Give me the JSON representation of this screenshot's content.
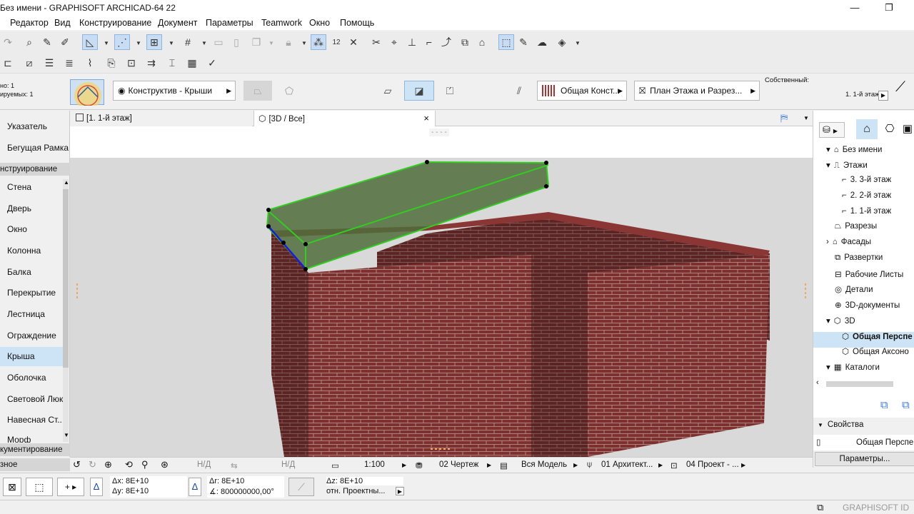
{
  "app": {
    "title": "Без имени - GRAPHISOFT ARCHICAD-64 22"
  },
  "window_buttons": {
    "minimize": "—",
    "maximize": "❐"
  },
  "menu": [
    "Редактор",
    "Вид",
    "Конструирование",
    "Документ",
    "Параметры",
    "Teamwork",
    "Окно",
    "Помощь"
  ],
  "infobox": {
    "left_info": [
      "но: 1",
      "ируемых: 1"
    ],
    "layer_combo": "Конструктив - Крыши",
    "material_combo": "Общая Конст...",
    "view_combo": "План Этажа и Разрез...",
    "own_label": "Собственный:",
    "floor_label": "1. 1-й этаж"
  },
  "toolbox": {
    "top_items": [
      "Указатель",
      "Бегущая Рамка"
    ],
    "group1": "нструирование",
    "items": [
      "Стена",
      "Дверь",
      "Окно",
      "Колонна",
      "Балка",
      "Перекрытие",
      "Лестница",
      "Ограждение",
      "Крыша",
      "Оболочка",
      "Световой Люк",
      "Навесная Ст...",
      "Морф"
    ],
    "selected": "Крыша",
    "group2": "кументирование",
    "group3": "зное"
  },
  "tabs": [
    {
      "label": "[1. 1-й этаж]"
    },
    {
      "label": "[3D / Все]",
      "close": "×"
    }
  ],
  "view_hint": "- - - -",
  "navigator": {
    "items": [
      {
        "label": "Без имени",
        "indent": 0,
        "toggle": "▾",
        "icon": "project-icon"
      },
      {
        "label": "Этажи",
        "indent": 1,
        "toggle": "▾",
        "icon": "stories-icon"
      },
      {
        "label": "3. 3-й этаж",
        "indent": 2,
        "toggle": "",
        "icon": "story-icon"
      },
      {
        "label": "2. 2-й этаж",
        "indent": 2,
        "toggle": "",
        "icon": "story-icon"
      },
      {
        "label": "1. 1-й этаж",
        "indent": 2,
        "toggle": "",
        "icon": "story-icon"
      },
      {
        "label": "Разрезы",
        "indent": 1,
        "toggle": "",
        "icon": "section-icon"
      },
      {
        "label": "Фасады",
        "indent": 1,
        "toggle": "›",
        "icon": "elevation-icon"
      },
      {
        "label": "Развертки",
        "indent": 1,
        "toggle": "",
        "icon": "interior-elevation-icon"
      },
      {
        "label": "Рабочие Листы",
        "indent": 1,
        "toggle": "",
        "icon": "worksheet-icon"
      },
      {
        "label": "Детали",
        "indent": 1,
        "toggle": "",
        "icon": "detail-icon"
      },
      {
        "label": "3D-документы",
        "indent": 1,
        "toggle": "",
        "icon": "3d-document-icon"
      },
      {
        "label": "3D",
        "indent": 1,
        "toggle": "▾",
        "icon": "3d-icon"
      },
      {
        "label": "Общая Перспе",
        "indent": 2,
        "toggle": "",
        "icon": "perspective-icon",
        "bold": true
      },
      {
        "label": "Общая Аксоно",
        "indent": 2,
        "toggle": "",
        "icon": "axonometry-icon"
      },
      {
        "label": "Каталоги",
        "indent": 1,
        "toggle": "▾",
        "icon": "schedule-icon"
      }
    ]
  },
  "properties": {
    "header": "Свойства",
    "view_name": "Общая Перспек",
    "params_button": "Параметры..."
  },
  "statusbar": {
    "nd1": "Н/Д",
    "nd2": "Н/Д",
    "scale": "1:100",
    "pen_set": "02 Чертеж",
    "model_view": "Вся Модель",
    "layer_combo": "01 Архитект...",
    "renovation": "04 Проект - ..."
  },
  "coords": {
    "dx": "Δx: 8E+10",
    "dy": "Δy: 8E+10",
    "dr": "Δr: 8E+10",
    "da": "∡: 800000000,00°",
    "dz": "Δz: 8E+10",
    "ref": "отн. Проектны..."
  },
  "bottom": {
    "brand": "GRAPHISOFT ID"
  },
  "colors": {
    "accent": "#cde4f7",
    "selection_green": "#2aa31a",
    "brick": "#7a2e2c"
  }
}
